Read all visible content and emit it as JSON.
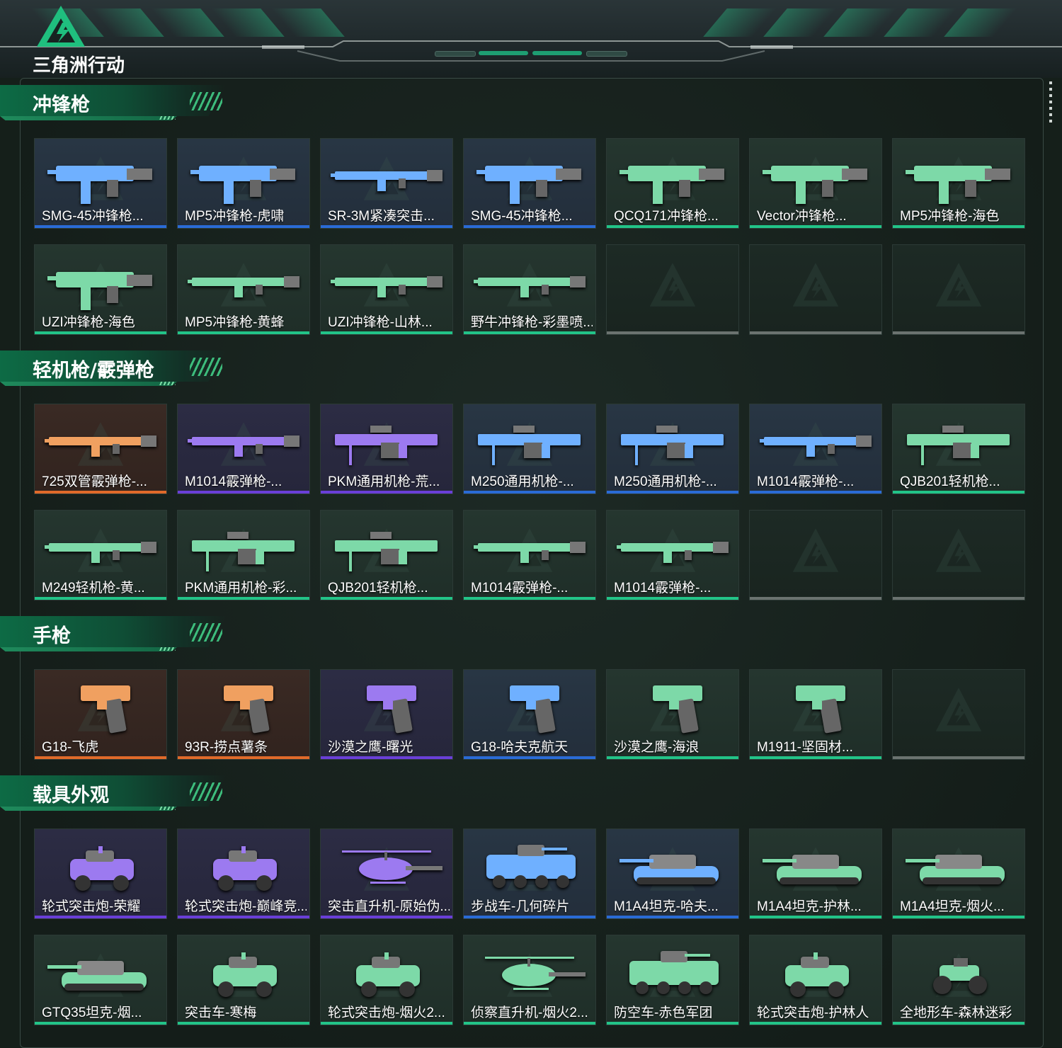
{
  "app": {
    "logo_text": "三角洲行动"
  },
  "colors": {
    "accent": "#1e9e72",
    "rarity": {
      "purple": "#6a3fd8",
      "blue": "#2a6bd6",
      "green": "#22c488",
      "orange": "#e06a2a",
      "empty": "#6b7370"
    }
  },
  "sections": [
    {
      "title": "冲锋枪",
      "items": [
        {
          "name": "SMG-45冲锋枪...",
          "rarity": "blue",
          "icon": "smg-icon"
        },
        {
          "name": "MP5冲锋枪-虎啸",
          "rarity": "blue",
          "icon": "smg-icon"
        },
        {
          "name": "SR-3M紧凑突击...",
          "rarity": "blue",
          "icon": "rifle-icon"
        },
        {
          "name": "SMG-45冲锋枪...",
          "rarity": "blue",
          "icon": "smg-icon"
        },
        {
          "name": "QCQ171冲锋枪...",
          "rarity": "green",
          "icon": "smg-icon"
        },
        {
          "name": "Vector冲锋枪...",
          "rarity": "green",
          "icon": "smg-icon"
        },
        {
          "name": "MP5冲锋枪-海色",
          "rarity": "green",
          "icon": "smg-icon"
        },
        {
          "name": "UZI冲锋枪-海色",
          "rarity": "green",
          "icon": "smg-icon"
        },
        {
          "name": "MP5冲锋枪-黄蜂",
          "rarity": "green",
          "icon": "rifle-icon"
        },
        {
          "name": "UZI冲锋枪-山林...",
          "rarity": "green",
          "icon": "rifle-icon"
        },
        {
          "name": "野牛冲锋枪-彩墨喷...",
          "rarity": "green",
          "icon": "rifle-icon"
        },
        {
          "name": "",
          "rarity": "empty",
          "icon": ""
        },
        {
          "name": "",
          "rarity": "empty",
          "icon": ""
        },
        {
          "name": "",
          "rarity": "empty",
          "icon": ""
        }
      ]
    },
    {
      "title": "轻机枪/霰弹枪",
      "items": [
        {
          "name": "725双管霰弹枪-...",
          "rarity": "orange",
          "icon": "rifle-icon"
        },
        {
          "name": "M1014霰弹枪-...",
          "rarity": "purple",
          "icon": "rifle-icon"
        },
        {
          "name": "PKM通用机枪-荒...",
          "rarity": "purple",
          "icon": "lmg-icon"
        },
        {
          "name": "M250通用机枪-...",
          "rarity": "blue",
          "icon": "lmg-icon"
        },
        {
          "name": "M250通用机枪-...",
          "rarity": "blue",
          "icon": "lmg-icon"
        },
        {
          "name": "M1014霰弹枪-...",
          "rarity": "blue",
          "icon": "rifle-icon"
        },
        {
          "name": "QJB201轻机枪...",
          "rarity": "green",
          "icon": "lmg-icon"
        },
        {
          "name": "M249轻机枪-黄...",
          "rarity": "green",
          "icon": "rifle-icon"
        },
        {
          "name": "PKM通用机枪-彩...",
          "rarity": "green",
          "icon": "lmg-icon"
        },
        {
          "name": "QJB201轻机枪...",
          "rarity": "green",
          "icon": "lmg-icon"
        },
        {
          "name": "M1014霰弹枪-...",
          "rarity": "green",
          "icon": "rifle-icon"
        },
        {
          "name": "M1014霰弹枪-...",
          "rarity": "green",
          "icon": "rifle-icon"
        },
        {
          "name": "",
          "rarity": "empty",
          "icon": ""
        },
        {
          "name": "",
          "rarity": "empty",
          "icon": ""
        }
      ]
    },
    {
      "title": "手枪",
      "items": [
        {
          "name": "G18-飞虎",
          "rarity": "orange",
          "icon": "pistol-icon"
        },
        {
          "name": "93R-捞点薯条",
          "rarity": "orange",
          "icon": "pistol-icon"
        },
        {
          "name": "沙漠之鹰-曙光",
          "rarity": "purple",
          "icon": "pistol-icon"
        },
        {
          "name": "G18-哈夫克航天",
          "rarity": "blue",
          "icon": "pistol-icon"
        },
        {
          "name": "沙漠之鹰-海浪",
          "rarity": "green",
          "icon": "pistol-icon"
        },
        {
          "name": "M1911-坚固材...",
          "rarity": "green",
          "icon": "pistol-icon"
        },
        {
          "name": "",
          "rarity": "empty",
          "icon": ""
        }
      ]
    },
    {
      "title": "载具外观",
      "items": [
        {
          "name": "轮式突击炮-荣耀",
          "rarity": "purple",
          "icon": "vehicle-icon"
        },
        {
          "name": "轮式突击炮-巅峰竞...",
          "rarity": "purple",
          "icon": "vehicle-icon"
        },
        {
          "name": "突击直升机-原始伪...",
          "rarity": "purple",
          "icon": "helicopter-icon"
        },
        {
          "name": "步战车-几何碎片",
          "rarity": "blue",
          "icon": "ifv-icon"
        },
        {
          "name": "M1A4坦克-哈夫...",
          "rarity": "blue",
          "icon": "tank-icon"
        },
        {
          "name": "M1A4坦克-护林...",
          "rarity": "green",
          "icon": "tank-icon"
        },
        {
          "name": "M1A4坦克-烟火...",
          "rarity": "green",
          "icon": "tank-icon"
        },
        {
          "name": "GTQ35坦克-烟...",
          "rarity": "green",
          "icon": "tank-icon"
        },
        {
          "name": "突击车-寒梅",
          "rarity": "green",
          "icon": "vehicle-icon"
        },
        {
          "name": "轮式突击炮-烟火2...",
          "rarity": "green",
          "icon": "vehicle-icon"
        },
        {
          "name": "侦察直升机-烟火2...",
          "rarity": "green",
          "icon": "helicopter-icon"
        },
        {
          "name": "防空车-赤色军团",
          "rarity": "green",
          "icon": "ifv-icon"
        },
        {
          "name": "轮式突击炮-护林人",
          "rarity": "green",
          "icon": "vehicle-icon"
        },
        {
          "name": "全地形车-森林迷彩",
          "rarity": "green",
          "icon": "atv-icon"
        }
      ]
    }
  ]
}
